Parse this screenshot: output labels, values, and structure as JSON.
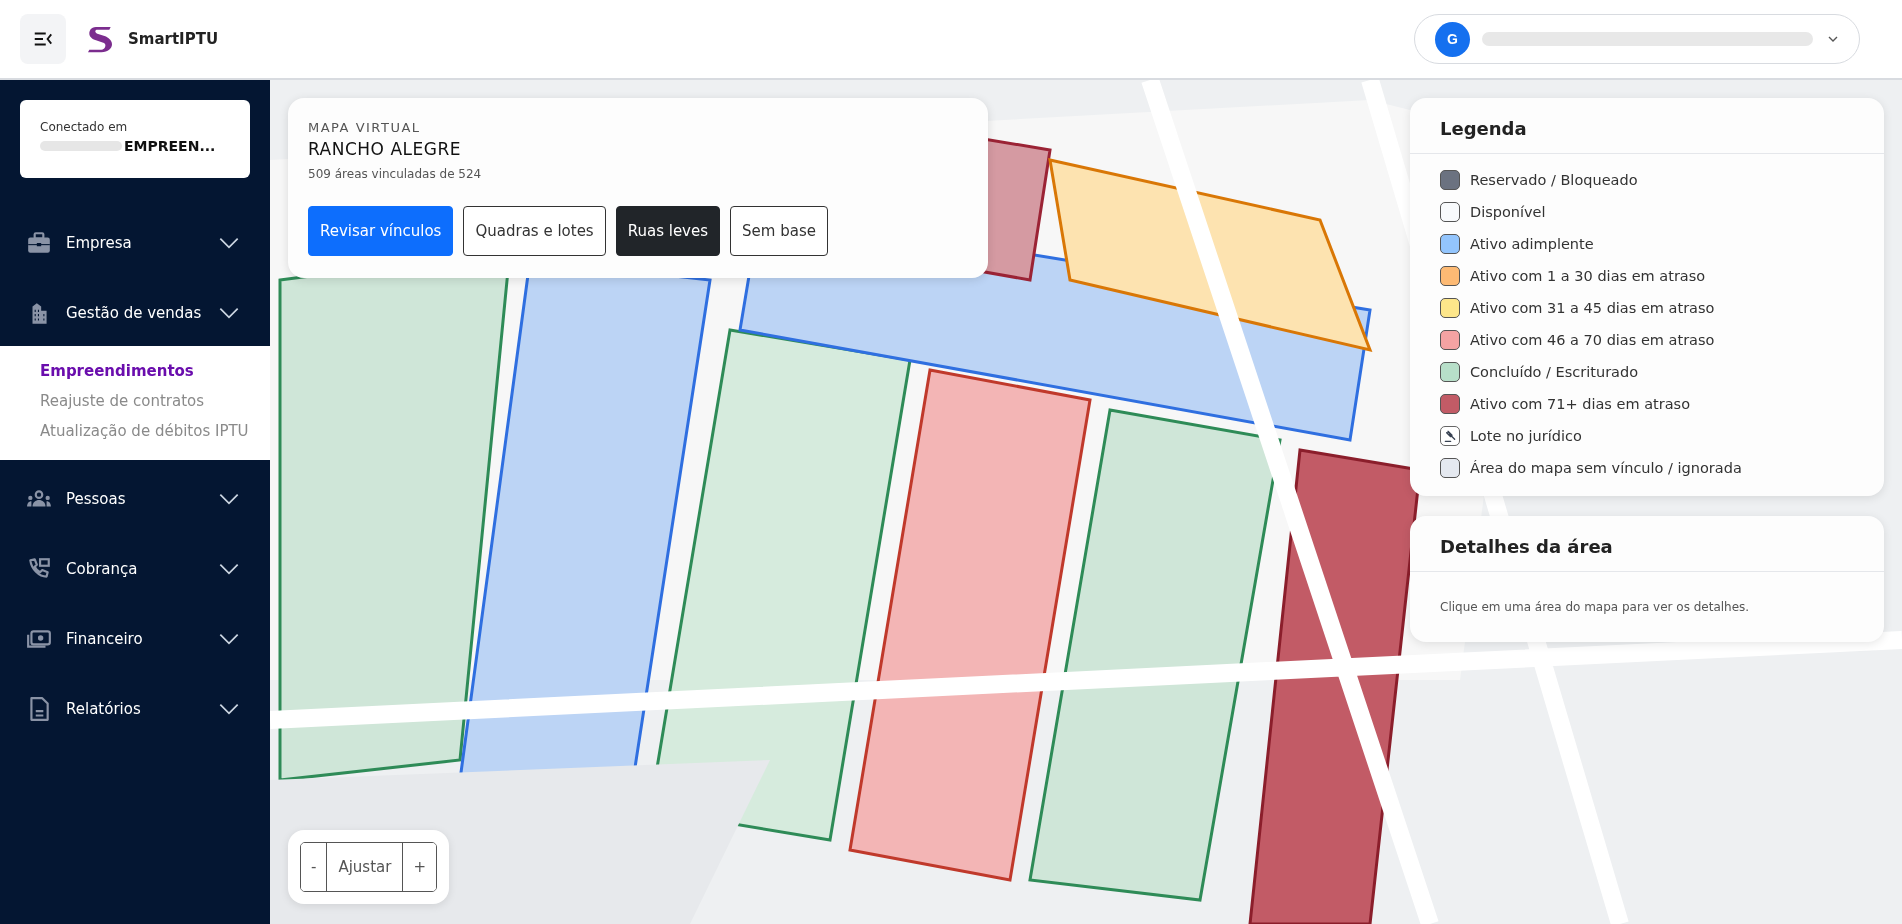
{
  "header": {
    "app_name": "SmartIPTU",
    "user": {
      "initial": "G"
    }
  },
  "sidebar": {
    "connection": {
      "label": "Conectado em",
      "value": "EMPREEN..."
    },
    "items": [
      {
        "label": "Empresa"
      },
      {
        "label": "Gestão de vendas",
        "expanded": true,
        "children": [
          {
            "label": "Empreendimentos",
            "selected": true
          },
          {
            "label": "Reajuste de contratos",
            "selected": false
          },
          {
            "label": "Atualização de débitos IPTU",
            "selected": false
          }
        ]
      },
      {
        "label": "Pessoas"
      },
      {
        "label": "Cobrança"
      },
      {
        "label": "Financeiro"
      },
      {
        "label": "Relatórios"
      }
    ]
  },
  "map_card": {
    "eyebrow": "MAPA VIRTUAL",
    "title": "RANCHO ALEGRE",
    "summary": "509 áreas vinculadas de 524",
    "action": {
      "label": "Revisar vínculos"
    },
    "base_layers": [
      {
        "label": "Quadras e lotes",
        "selected": false
      },
      {
        "label": "Ruas leves",
        "selected": true
      },
      {
        "label": "Sem base",
        "selected": false
      }
    ]
  },
  "legend": {
    "title": "Legenda",
    "items": [
      {
        "label": "Reservado / Bloqueado",
        "kind": "swatch",
        "color": "#6b7280"
      },
      {
        "label": "Disponível",
        "kind": "swatch",
        "color": "#f8fafc"
      },
      {
        "label": "Ativo adimplente",
        "kind": "swatch",
        "color": "#93c5fd"
      },
      {
        "label": "Ativo com 1 a 30 dias em atraso",
        "kind": "swatch",
        "color": "#fdba74"
      },
      {
        "label": "Ativo com 31 a 45 dias em atraso",
        "kind": "swatch",
        "color": "#fde68a"
      },
      {
        "label": "Ativo com 46 a 70 dias em atraso",
        "kind": "swatch",
        "color": "#f4a3a3"
      },
      {
        "label": "Concluído / Escriturado",
        "kind": "swatch",
        "color": "#b7dfc9"
      },
      {
        "label": "Ativo com 71+ dias em atraso",
        "kind": "swatch",
        "color": "#c25b66"
      },
      {
        "label": "Lote no jurídico",
        "kind": "gavel"
      },
      {
        "label": "Área do mapa sem vínculo / ignorada",
        "kind": "swatch",
        "color": "#e5e9f0"
      }
    ]
  },
  "details": {
    "title": "Detalhes da área",
    "hint": "Clique em uma área do mapa para ver os detalhes."
  },
  "zoom_controls": {
    "minus": "-",
    "fit": "Ajustar",
    "plus": "+"
  }
}
